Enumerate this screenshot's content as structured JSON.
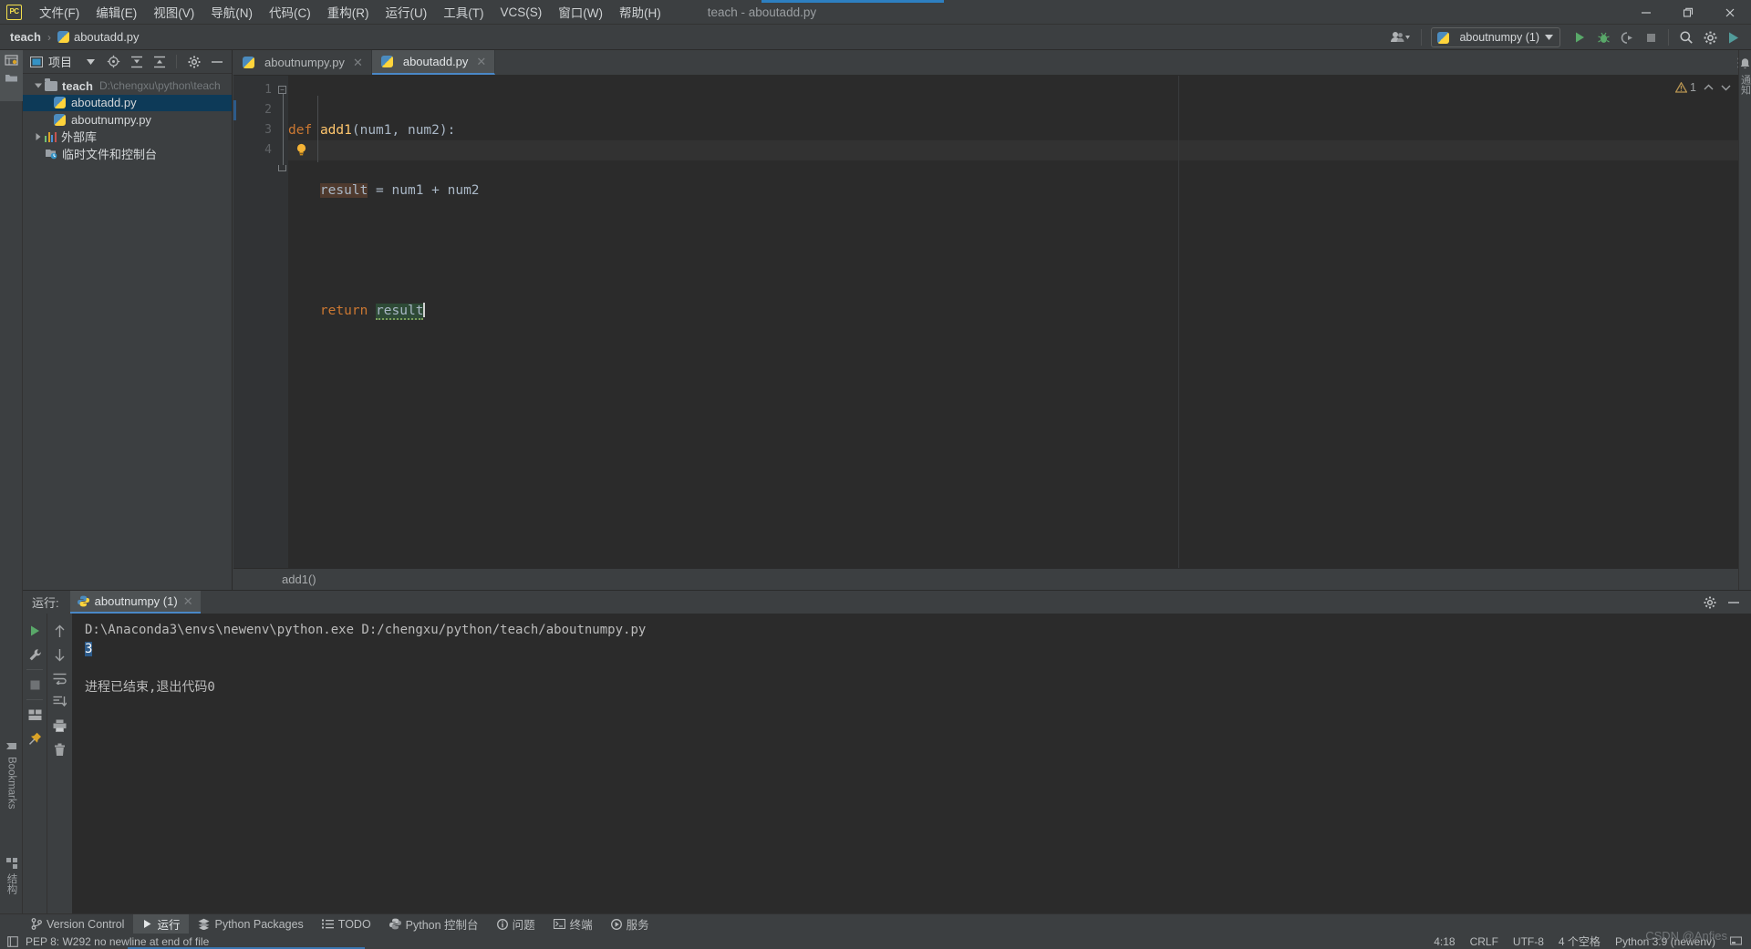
{
  "window": {
    "title": "teach - aboutadd.py",
    "logo_text": "PC",
    "minimize": "minimize-icon",
    "maximize": "maximize-icon",
    "close": "close-icon"
  },
  "menu": [
    {
      "label": "文件(F)"
    },
    {
      "label": "编辑(E)"
    },
    {
      "label": "视图(V)"
    },
    {
      "label": "导航(N)"
    },
    {
      "label": "代码(C)"
    },
    {
      "label": "重构(R)"
    },
    {
      "label": "运行(U)"
    },
    {
      "label": "工具(T)"
    },
    {
      "label": "VCS(S)"
    },
    {
      "label": "窗口(W)"
    },
    {
      "label": "帮助(H)"
    }
  ],
  "breadcrumb": {
    "project": "teach",
    "separator": "›",
    "file": "aboutadd.py"
  },
  "toolbar": {
    "account_icon": "user-avatar-icon",
    "run_config": "aboutnumpy (1)",
    "run_icon": "run-icon",
    "debug_icon": "debug-icon",
    "coverage_icon": "run-with-coverage-icon",
    "stop_icon": "stop-icon",
    "search_icon": "search-everywhere-icon",
    "settings_icon": "settings-icon",
    "updates_icon": "updates-icon"
  },
  "left_strip": {
    "project_tab": "project-icon",
    "structure_tab_label": "结构",
    "bookmarks_tab_label": "Bookmarks"
  },
  "project_panel": {
    "title": "项目",
    "buttons": [
      {
        "name": "select-opened-file-icon"
      },
      {
        "name": "expand-all-icon"
      },
      {
        "name": "collapse-all-icon"
      },
      {
        "name": "settings-icon"
      },
      {
        "name": "hide-icon"
      }
    ],
    "tree": [
      {
        "label": "teach",
        "path": "D:\\chengxu\\python\\teach",
        "type": "folder",
        "expanded": true,
        "depth": 0,
        "selected": false
      },
      {
        "label": "aboutadd.py",
        "path": "",
        "type": "python",
        "depth": 1,
        "selected": true
      },
      {
        "label": "aboutnumpy.py",
        "path": "",
        "type": "python",
        "depth": 1,
        "selected": false
      },
      {
        "label": "外部库",
        "path": "",
        "type": "library",
        "expanded": false,
        "depth": 0,
        "selected": false
      },
      {
        "label": "临时文件和控制台",
        "path": "",
        "type": "scratch",
        "depth": 0,
        "selected": false
      }
    ]
  },
  "editor": {
    "tabs": [
      {
        "label": "aboutnumpy.py",
        "active": false
      },
      {
        "label": "aboutadd.py",
        "active": true
      }
    ],
    "line_numbers": [
      "1",
      "2",
      "3",
      "4"
    ],
    "lines": [
      {
        "n": 1,
        "text": "def add1(num1, num2):"
      },
      {
        "n": 2,
        "text": "    result = num1 + num2"
      },
      {
        "n": 3,
        "text": ""
      },
      {
        "n": 4,
        "text": "    return result"
      }
    ],
    "tokens": {
      "kw_def": "def",
      "fn_name": "add1",
      "params": "(num1, num2):",
      "var_result": "result",
      "assign": " = num1 + num2",
      "kw_return": "return",
      "var_result2": "result"
    },
    "inspection": {
      "warning_count": "1",
      "warning_icon": "warning-triangle-icon",
      "up_icon": "previous-problem-icon",
      "down_icon": "next-problem-icon",
      "more_icon": "inspections-menu-icon"
    },
    "bulb_icon": "intention-bulb-icon",
    "structure_breadcrumb": "add1()"
  },
  "run_window": {
    "label": "运行:",
    "tab": "aboutnumpy (1)",
    "tab_close": "close-icon",
    "settings_icon": "settings-icon",
    "hide_icon": "hide-icon",
    "left_buttons": [
      {
        "name": "rerun-icon"
      },
      {
        "name": "edit-configuration-icon"
      },
      {
        "name": "stop-icon"
      },
      {
        "name": "layout-icon"
      },
      {
        "name": "pin-tab-icon"
      }
    ],
    "right_buttons": [
      {
        "name": "scroll-up-icon"
      },
      {
        "name": "scroll-down-icon"
      },
      {
        "name": "soft-wrap-icon"
      },
      {
        "name": "scroll-to-end-icon"
      },
      {
        "name": "print-icon"
      },
      {
        "name": "clear-all-icon"
      }
    ],
    "console": {
      "command": "D:\\Anaconda3\\envs\\newenv\\python.exe D:/chengxu/python/teach/aboutnumpy.py",
      "output": "3",
      "exit_message": "进程已结束,退出代码0"
    }
  },
  "bottom_tabs": [
    {
      "label": "Version Control",
      "icon": "branch-icon",
      "active": false
    },
    {
      "label": "运行",
      "icon": "run-icon",
      "active": true
    },
    {
      "label": "Python Packages",
      "icon": "packages-icon",
      "active": false
    },
    {
      "label": "TODO",
      "icon": "todo-icon",
      "active": false
    },
    {
      "label": "Python 控制台",
      "icon": "python-console-icon",
      "active": false
    },
    {
      "label": "问题",
      "icon": "problems-icon",
      "active": false
    },
    {
      "label": "终端",
      "icon": "terminal-icon",
      "active": false
    },
    {
      "label": "服务",
      "icon": "services-icon",
      "active": false
    }
  ],
  "status_bar": {
    "message": "PEP 8: W292 no newline at end of file",
    "message_icon": "inspection-icon",
    "caret_position": "4:18",
    "line_separator": "CRLF",
    "encoding": "UTF-8",
    "indent": "4 个空格",
    "interpreter": "Python 3.9 (newenv)",
    "lock_icon": "read-only-icon"
  },
  "right_strip": {
    "notifications_label": "通知",
    "notifications_icon": "bell-icon"
  },
  "watermark": "CSDN @Anfies",
  "colors": {
    "bg": "#3c3f41",
    "editor_bg": "#2b2b2b",
    "accent_blue": "#4a88c7",
    "selection_blue": "#0d3a58",
    "keyword_orange": "#cc7832",
    "function_yellow": "#ffc66d",
    "text": "#a9b7c6",
    "run_green": "#499c54"
  }
}
